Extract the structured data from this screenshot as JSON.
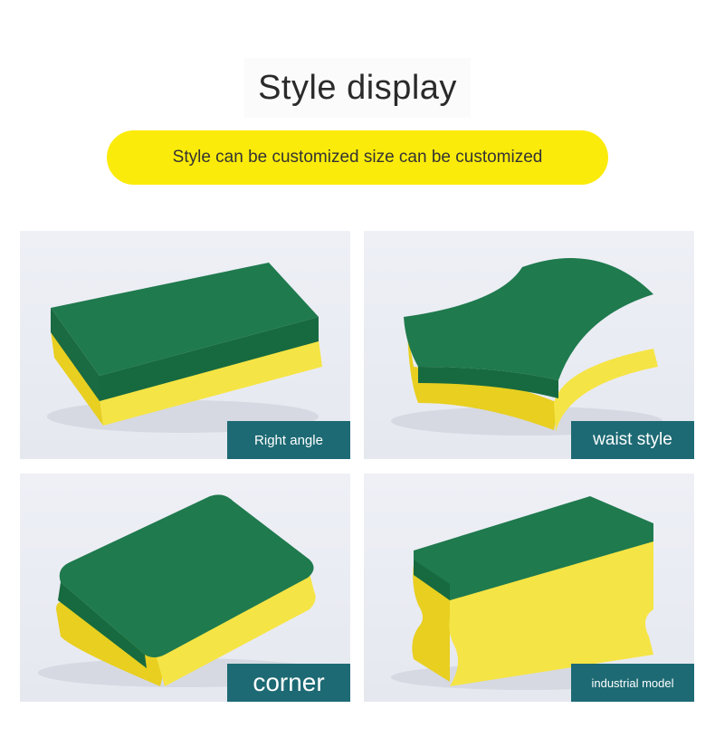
{
  "header": {
    "title": "Style display",
    "subtitle": "Style can be customized size can be customized"
  },
  "styles": [
    {
      "label": "Right angle"
    },
    {
      "label": "waist style"
    },
    {
      "label": "corner"
    },
    {
      "label": "industrial model"
    }
  ],
  "colors": {
    "banner": "#fbeb0a",
    "label_bg": "#1d6a74",
    "sponge_yellow": "#f2df3a",
    "scrub_green": "#1f7a4e"
  }
}
